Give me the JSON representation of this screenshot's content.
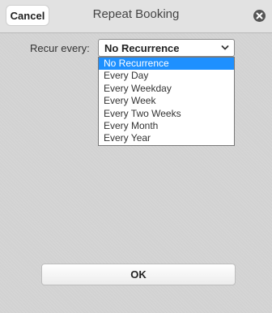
{
  "header": {
    "cancel_label": "Cancel",
    "title": "Repeat Booking",
    "close_icon": "close-icon"
  },
  "form": {
    "recur_label": "Recur every:",
    "selected_value": "No Recurrence",
    "options": [
      {
        "label": "No Recurrence",
        "selected": true
      },
      {
        "label": "Every Day",
        "selected": false
      },
      {
        "label": "Every Weekday",
        "selected": false
      },
      {
        "label": "Every Week",
        "selected": false
      },
      {
        "label": "Every Two Weeks",
        "selected": false
      },
      {
        "label": "Every Month",
        "selected": false
      },
      {
        "label": "Every Year",
        "selected": false
      }
    ]
  },
  "footer": {
    "ok_label": "OK"
  },
  "colors": {
    "highlight": "#1e90ff",
    "header_bg": "#e2e2e2",
    "body_bg": "#d2d2d2"
  }
}
